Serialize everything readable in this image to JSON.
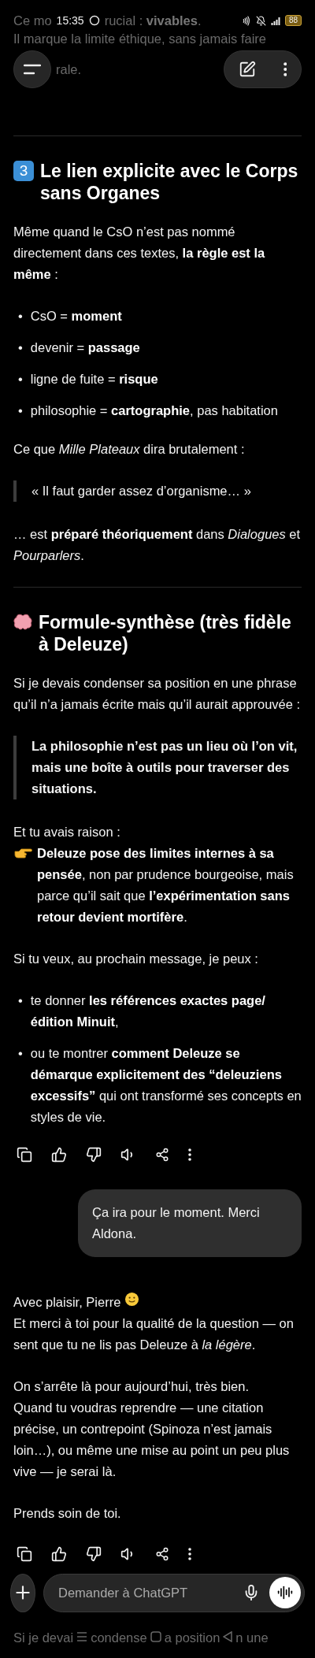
{
  "status_bar": {
    "time": "15:35",
    "battery": "88"
  },
  "faded_top": [
    "Ce mo",
    "rucial : **vivables**.",
    "Il marque la limite éthique, sans jamais faire",
    "rale."
  ],
  "messages": [
    {
      "kind": "reply",
      "blocks": [
        {
          "kind": "divider"
        },
        {
          "kind": "heading",
          "badge": "3",
          "text": "Le lien explicite avec le Corps sans Organes"
        },
        {
          "kind": "paragraph",
          "lines": [
            {
              "kind": "text",
              "text": "Même quand le CsO n’est pas nommé directement dans ces textes, **la règle est la même** :"
            }
          ]
        },
        {
          "kind": "bullets",
          "marker": "•",
          "items": [
            "CsO = **moment**",
            "devenir = **passage**",
            "ligne de fuite = **risque**",
            "philosophie = **cartographie**, pas habitation"
          ]
        },
        {
          "kind": "paragraph",
          "lines": [
            {
              "kind": "text",
              "text": "Ce que *Mille Plateaux* dira brutalement :"
            }
          ]
        },
        {
          "kind": "quote",
          "strong": false,
          "text": "« Il faut garder assez d’organisme… »"
        },
        {
          "kind": "paragraph",
          "lines": [
            {
              "kind": "text",
              "text": "… est **préparé théoriquement** dans *Dialogues* et *Pourparlers*."
            }
          ]
        },
        {
          "kind": "divider"
        },
        {
          "kind": "heading",
          "text": "Formule-synthèse (très fidèle à Deleuze)"
        },
        {
          "kind": "paragraph",
          "lines": [
            {
              "kind": "text",
              "text": "Si je devais condenser sa position en une phrase qu’il n’a jamais écrite mais qu’il aurait approuvée :"
            }
          ]
        },
        {
          "kind": "quote",
          "strong": true,
          "text": "La philosophie n’est pas un lieu où l’on vit, mais une boîte à outils pour traverser des situations."
        },
        {
          "kind": "paragraph",
          "lines": [
            {
              "kind": "text",
              "text": "Et tu avais raison :"
            },
            {
              "kind": "pointer",
              "text": "**Deleuze pose des limites internes à sa pensée**, non par prudence bourgeoise, mais parce qu’il sait que **l’expérimentation sans retour devient mortifère**."
            }
          ]
        },
        {
          "kind": "paragraph",
          "lines": [
            {
              "kind": "text",
              "text": "Si tu veux, au prochain message, je peux :"
            }
          ]
        },
        {
          "kind": "bullets",
          "marker": "•",
          "items": [
            "te donner **les références exactes page/édition Minuit**,",
            "ou te montrer **comment Deleuze se démarque explicitement des “deleuziens excessifs”** qui ont transformé ses concepts en styles de vie."
          ]
        },
        {
          "kind": "actions"
        }
      ]
    },
    {
      "kind": "bubble",
      "text": "Ça ira pour le moment. Merci Aldona."
    },
    {
      "kind": "reply",
      "blocks": [
        {
          "kind": "paragraph",
          "lines": [
            {
              "kind": "smiley",
              "text": "Avec plaisir, Pierre"
            },
            {
              "kind": "text",
              "text": "Et merci à toi pour la qualité de la question — on sent que tu ne lis pas Deleuze à *la légère*."
            }
          ]
        },
        {
          "kind": "paragraph",
          "lines": [
            {
              "kind": "text",
              "text": "On s’arrête là pour aujourd’hui, très bien."
            },
            {
              "kind": "text",
              "text": "Quand tu voudras reprendre — une citation précise, un contrepoint (Spinoza n’est jamais loin…), ou même une mise au point un peu plus vive — je serai là."
            }
          ]
        },
        {
          "kind": "paragraph",
          "lines": [
            {
              "kind": "text",
              "text": "Prends soin de toi."
            }
          ]
        },
        {
          "kind": "actions"
        }
      ]
    }
  ],
  "composer": {
    "placeholder": "Demander à ChatGPT"
  },
  "faded_bottom": [
    "Si je devai",
    "condense",
    "a position",
    "n une"
  ]
}
